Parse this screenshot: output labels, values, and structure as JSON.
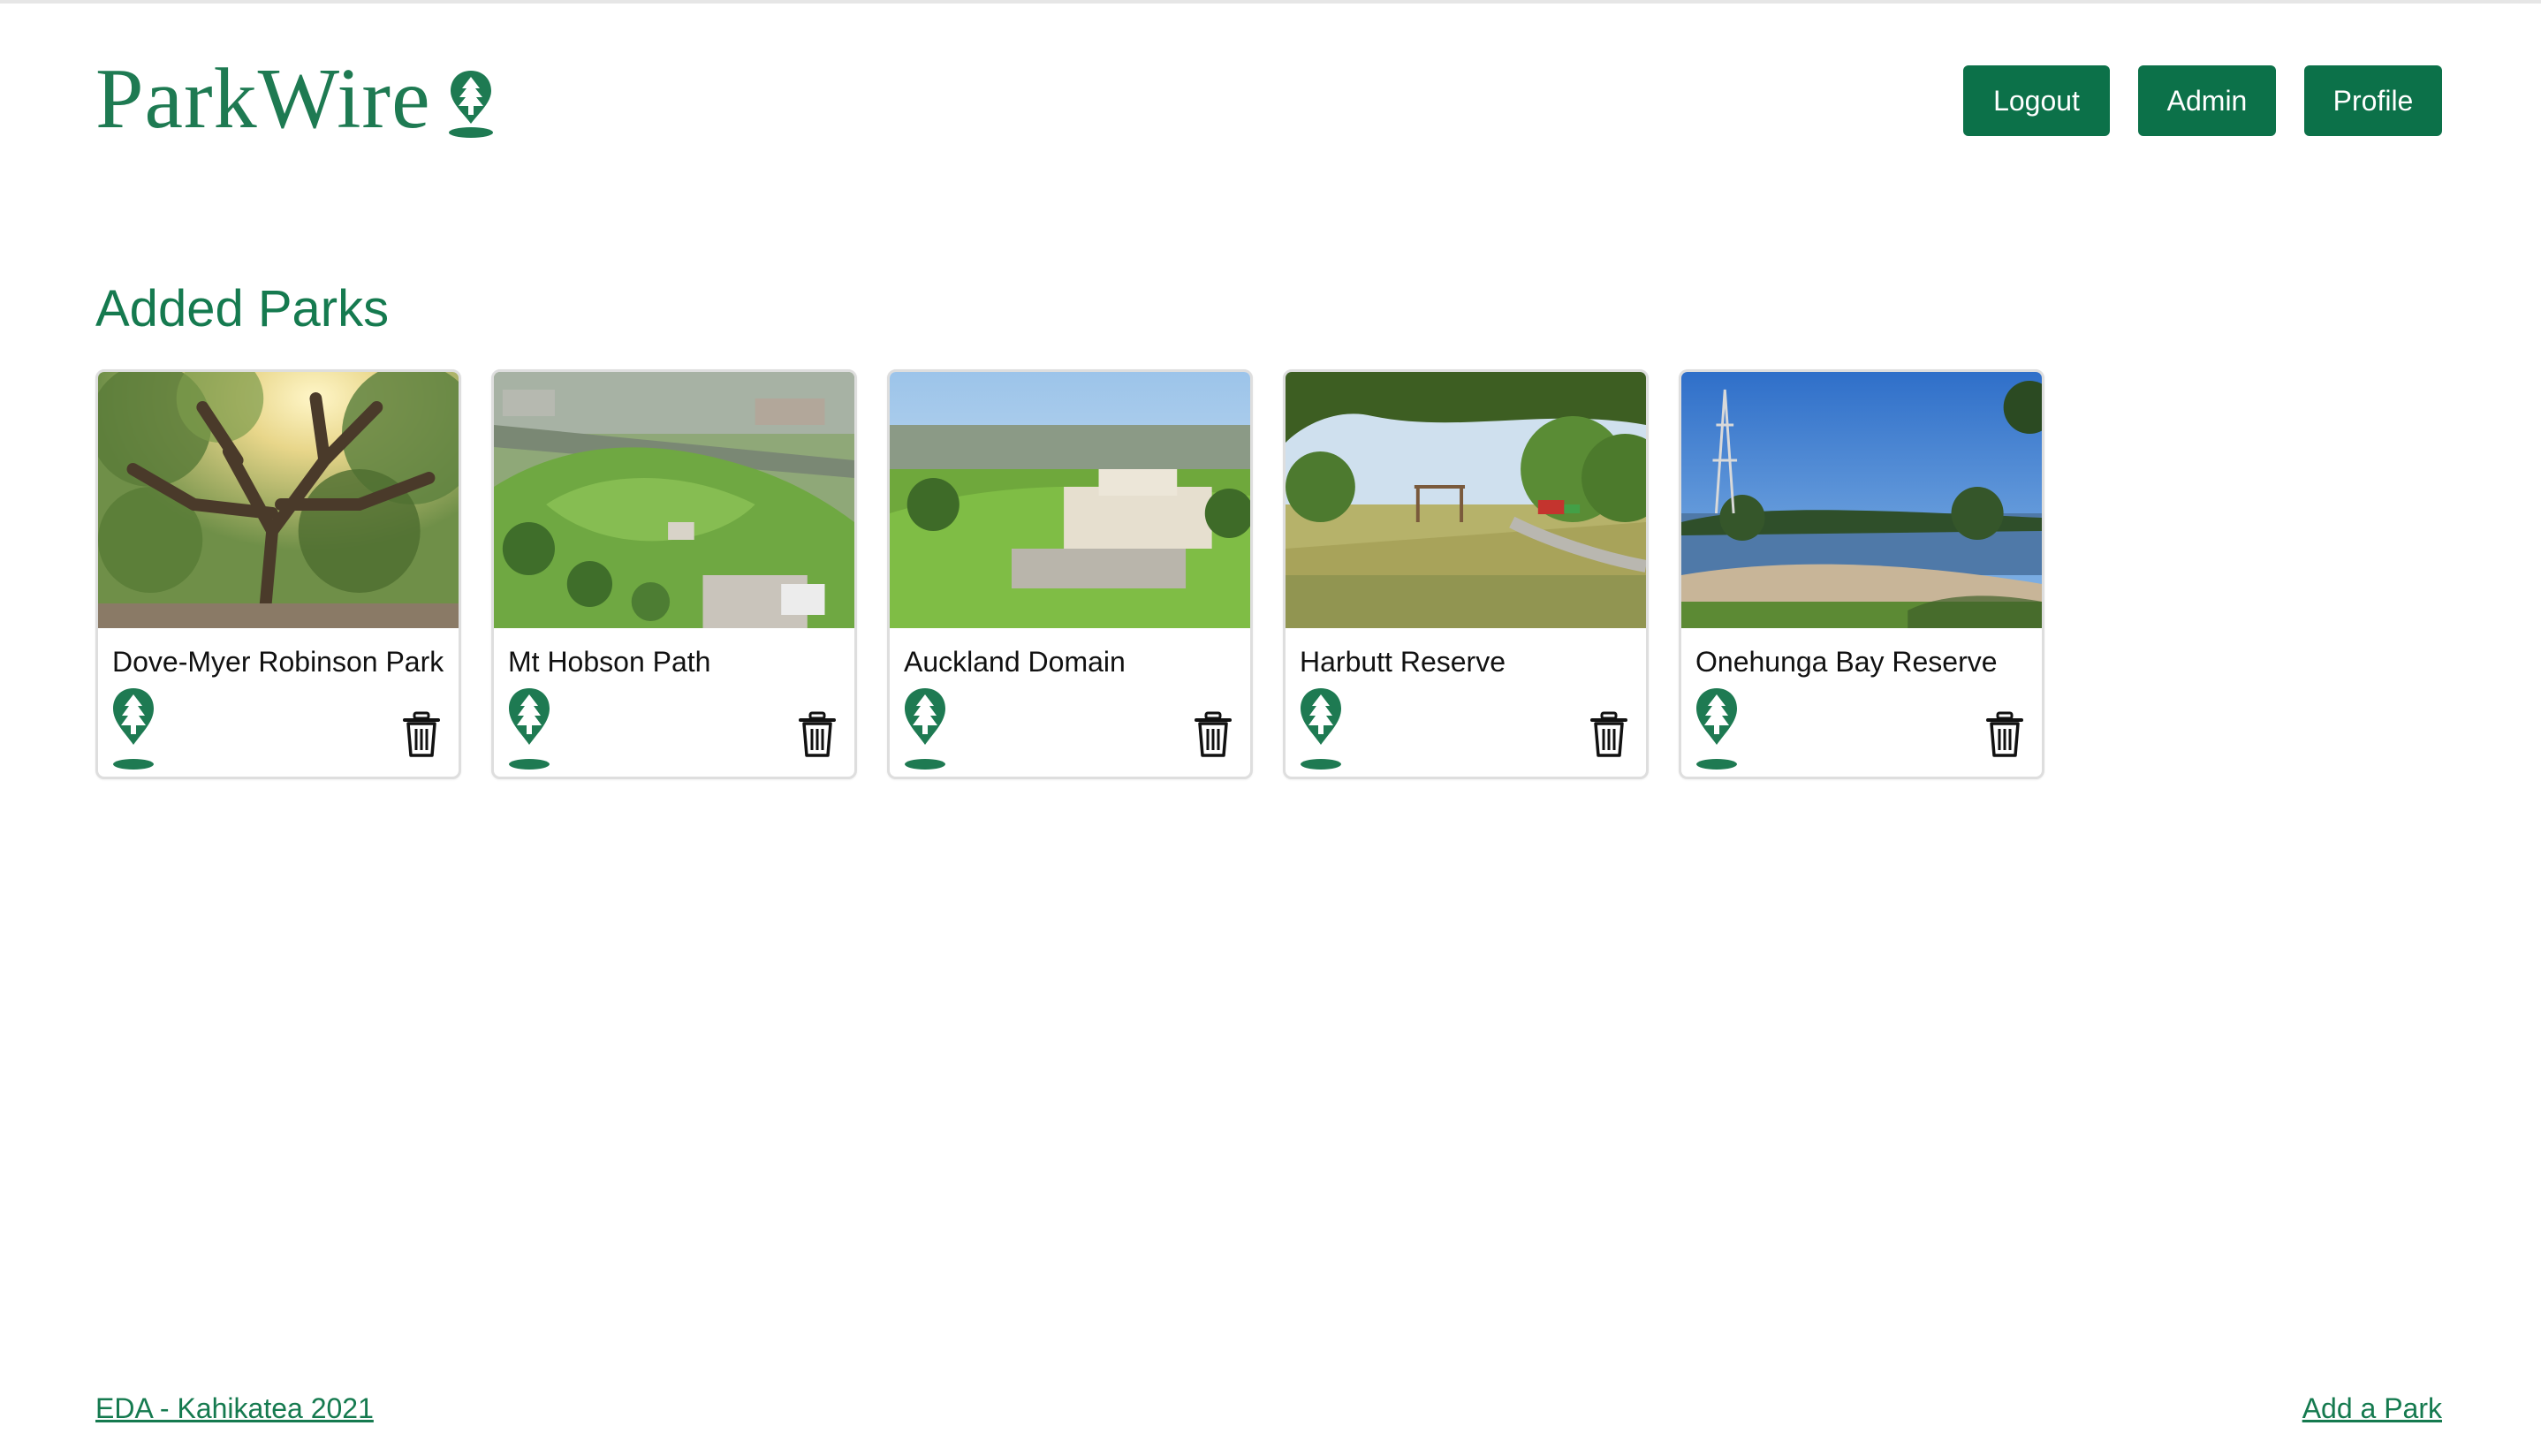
{
  "brand": {
    "name": "ParkWire",
    "color": "#1e7a52",
    "icon": "tree-pin-icon"
  },
  "nav": {
    "logout_label": "Logout",
    "admin_label": "Admin",
    "profile_label": "Profile",
    "button_color": "#0c7149"
  },
  "main": {
    "title": "Added Parks",
    "parks": [
      {
        "name": "Dove-Myer Robinson Park",
        "image": "park-photo-tree-canopy"
      },
      {
        "name": "Mt Hobson Path",
        "image": "park-photo-aerial-hill"
      },
      {
        "name": "Auckland Domain",
        "image": "park-photo-museum-lawn"
      },
      {
        "name": "Harbutt Reserve",
        "image": "park-photo-playground-field"
      },
      {
        "name": "Onehunga Bay Reserve",
        "image": "park-photo-lake-shore"
      }
    ],
    "card_icons": {
      "pin": "tree-pin-icon",
      "delete": "trash-icon"
    }
  },
  "footer": {
    "left_link": "EDA - Kahikatea 2021",
    "right_link": "Add a Park"
  }
}
